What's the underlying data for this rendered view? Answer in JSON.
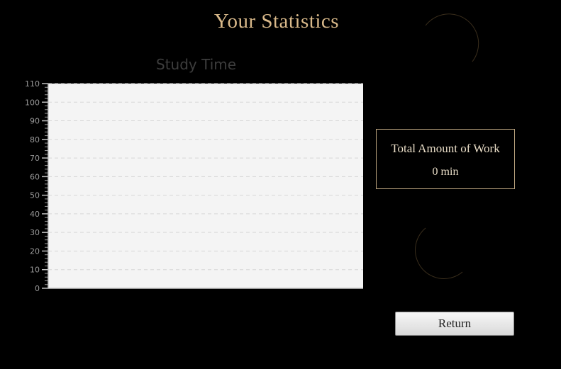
{
  "page": {
    "title": "Your Statistics"
  },
  "chart_data": {
    "type": "bar",
    "title": "Study Time",
    "xlabel": "",
    "ylabel": "",
    "categories": [],
    "values": [],
    "ylim": [
      0,
      110
    ],
    "major_ticks": [
      0,
      10,
      20,
      30,
      40,
      50,
      60,
      70,
      80,
      90,
      100,
      110
    ],
    "grid": true,
    "plot_bg": "#f4f4f4"
  },
  "summary": {
    "label": "Total Amount of Work",
    "value": "0 min"
  },
  "buttons": {
    "return_label": "Return"
  },
  "icons": [
    "crescent-moon-icon",
    "crescent-moon-icon"
  ],
  "colors": {
    "background": "#000000",
    "accent": "#d9b98a",
    "box_border": "#b9a27d"
  }
}
